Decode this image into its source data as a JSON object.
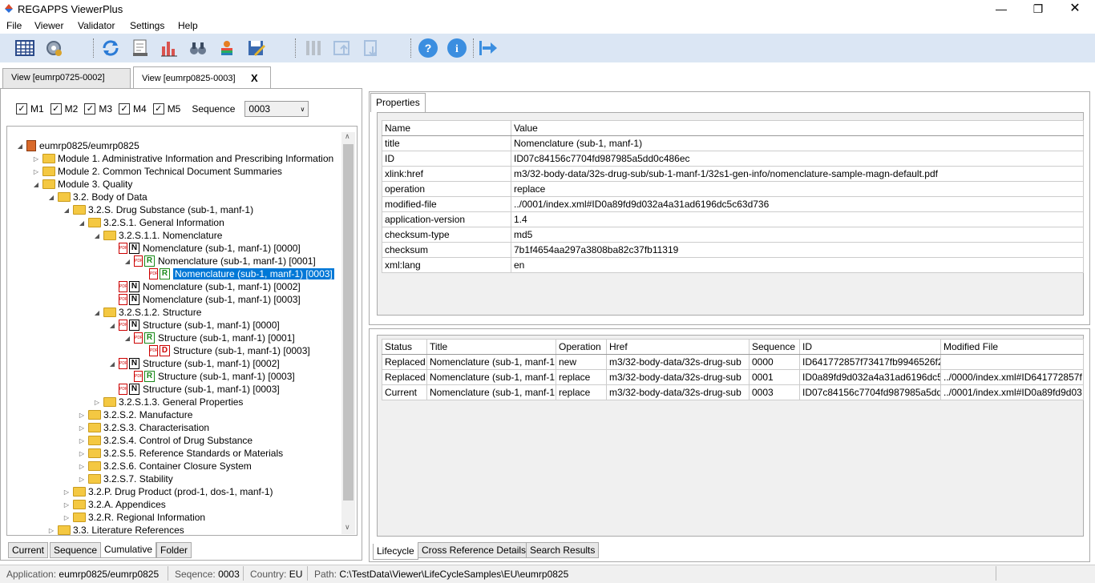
{
  "app": {
    "title": "REGAPPS ViewerPlus"
  },
  "menu": [
    "File",
    "Viewer",
    "Validator",
    "Settings",
    "Help"
  ],
  "toolbar": {
    "icons": [
      "table-icon",
      "settings-gear-icon",
      "refresh-icon",
      "report-icon",
      "chart-icon",
      "binoculars-icon",
      "user-icon",
      "save-icon",
      "columns-icon",
      "import-icon",
      "export-icon",
      "help-icon",
      "info-icon",
      "exit-icon"
    ]
  },
  "tabs": [
    {
      "label": "View [eumrp0725-0002]"
    },
    {
      "label": "View [eumrp0825-0003]",
      "close": "X"
    }
  ],
  "filter": {
    "m": [
      "M1",
      "M2",
      "M3",
      "M4",
      "M5"
    ],
    "seq_label": "Sequence",
    "seq_value": "0003"
  },
  "tree": [
    {
      "label": "eumrp0825/eumrp0825",
      "t": "doc"
    },
    {
      "label": "Module 1. Administrative Information and Prescribing Information",
      "t": "folder"
    },
    {
      "label": "Module 2. Common Technical Document Summaries",
      "t": "folder"
    },
    {
      "label": "Module 3. Quality",
      "t": "folder"
    },
    {
      "label": "3.2. Body of Data",
      "t": "folder"
    },
    {
      "label": "3.2.S. Drug Substance (sub-1, manf-1)",
      "t": "folder"
    },
    {
      "label": "3.2.S.1. General Information",
      "t": "folder"
    },
    {
      "label": "3.2.S.1.1. Nomenclature",
      "t": "folder"
    },
    {
      "label": "Nomenclature (sub-1, manf-1) [0000]",
      "t": "N"
    },
    {
      "label": "Nomenclature (sub-1, manf-1) [0001]",
      "t": "R"
    },
    {
      "label": "Nomenclature (sub-1, manf-1) [0003]",
      "t": "R",
      "sel": true
    },
    {
      "label": "Nomenclature (sub-1, manf-1) [0002]",
      "t": "N"
    },
    {
      "label": "Nomenclature (sub-1, manf-1) [0003]",
      "t": "N"
    },
    {
      "label": "3.2.S.1.2. Structure",
      "t": "folder"
    },
    {
      "label": "Structure (sub-1, manf-1) [0000]",
      "t": "N"
    },
    {
      "label": "Structure (sub-1, manf-1) [0001]",
      "t": "R"
    },
    {
      "label": "Structure (sub-1, manf-1) [0003]",
      "t": "D"
    },
    {
      "label": "Structure (sub-1, manf-1) [0002]",
      "t": "N"
    },
    {
      "label": "Structure (sub-1, manf-1) [0003]",
      "t": "R"
    },
    {
      "label": "Structure (sub-1, manf-1) [0003]",
      "t": "N"
    },
    {
      "label": "3.2.S.1.3. General Properties",
      "t": "folder"
    },
    {
      "label": "3.2.S.2. Manufacture",
      "t": "folder"
    },
    {
      "label": "3.2.S.3. Characterisation",
      "t": "folder"
    },
    {
      "label": "3.2.S.4. Control of Drug Substance",
      "t": "folder"
    },
    {
      "label": "3.2.S.5. Reference Standards or Materials",
      "t": "folder"
    },
    {
      "label": "3.2.S.6. Container Closure System",
      "t": "folder"
    },
    {
      "label": "3.2.S.7. Stability",
      "t": "folder"
    },
    {
      "label": "3.2.P. Drug Product (prod-1, dos-1, manf-1)",
      "t": "folder"
    },
    {
      "label": "3.2.A. Appendices",
      "t": "folder"
    },
    {
      "label": "3.2.R. Regional Information",
      "t": "folder"
    },
    {
      "label": "3.3. Literature References",
      "t": "folder"
    }
  ],
  "left_tabs": [
    "Current",
    "Sequence",
    "Cumulative",
    "Folder"
  ],
  "properties": {
    "tab": "Properties",
    "headers": [
      "Name",
      "Value"
    ],
    "rows": [
      [
        "title",
        "Nomenclature (sub-1, manf-1)"
      ],
      [
        "ID",
        "ID07c84156c7704fd987985a5dd0c486ec"
      ],
      [
        "xlink:href",
        "m3/32-body-data/32s-drug-sub/sub-1-manf-1/32s1-gen-info/nomenclature-sample-magn-default.pdf"
      ],
      [
        "operation",
        "replace"
      ],
      [
        "modified-file",
        "../0001/index.xml#ID0a89fd9d032a4a31ad6196dc5c63d736"
      ],
      [
        "application-version",
        "1.4"
      ],
      [
        "checksum-type",
        "md5"
      ],
      [
        "checksum",
        "7b1f4654aa297a3808ba82c37fb11319"
      ],
      [
        "xml:lang",
        "en"
      ]
    ]
  },
  "lifecycle": {
    "headers": [
      "Status",
      "Title",
      "Operation",
      "Href",
      "Sequence",
      "ID",
      "Modified File"
    ],
    "rows": [
      [
        "Replaced",
        "Nomenclature (sub-1, manf-1",
        "new",
        "m3/32-body-data/32s-drug-sub",
        "0000",
        "ID641772857f73417fb9946526f2",
        ""
      ],
      [
        "Replaced",
        "Nomenclature (sub-1, manf-1",
        "replace",
        "m3/32-body-data/32s-drug-sub",
        "0001",
        "ID0a89fd9d032a4a31ad6196dc5",
        "../0000/index.xml#ID641772857f"
      ],
      [
        "Current",
        "Nomenclature (sub-1, manf-1",
        "replace",
        "m3/32-body-data/32s-drug-sub",
        "0003",
        "ID07c84156c7704fd987985a5dd",
        "../0001/index.xml#ID0a89fd9d03"
      ]
    ]
  },
  "right_tabs": [
    "Lifecycle",
    "Cross Reference Details",
    "Search Results"
  ],
  "status": {
    "application_label": "Application:",
    "application": "eumrp0825/eumrp0825",
    "sequence_label": "Seqence:",
    "sequence": "0003",
    "country_label": "Country:",
    "country": "EU",
    "path_label": "Path:",
    "path": "C:\\TestData\\Viewer\\LifeCycleSamples\\EU\\eumrp0825"
  }
}
